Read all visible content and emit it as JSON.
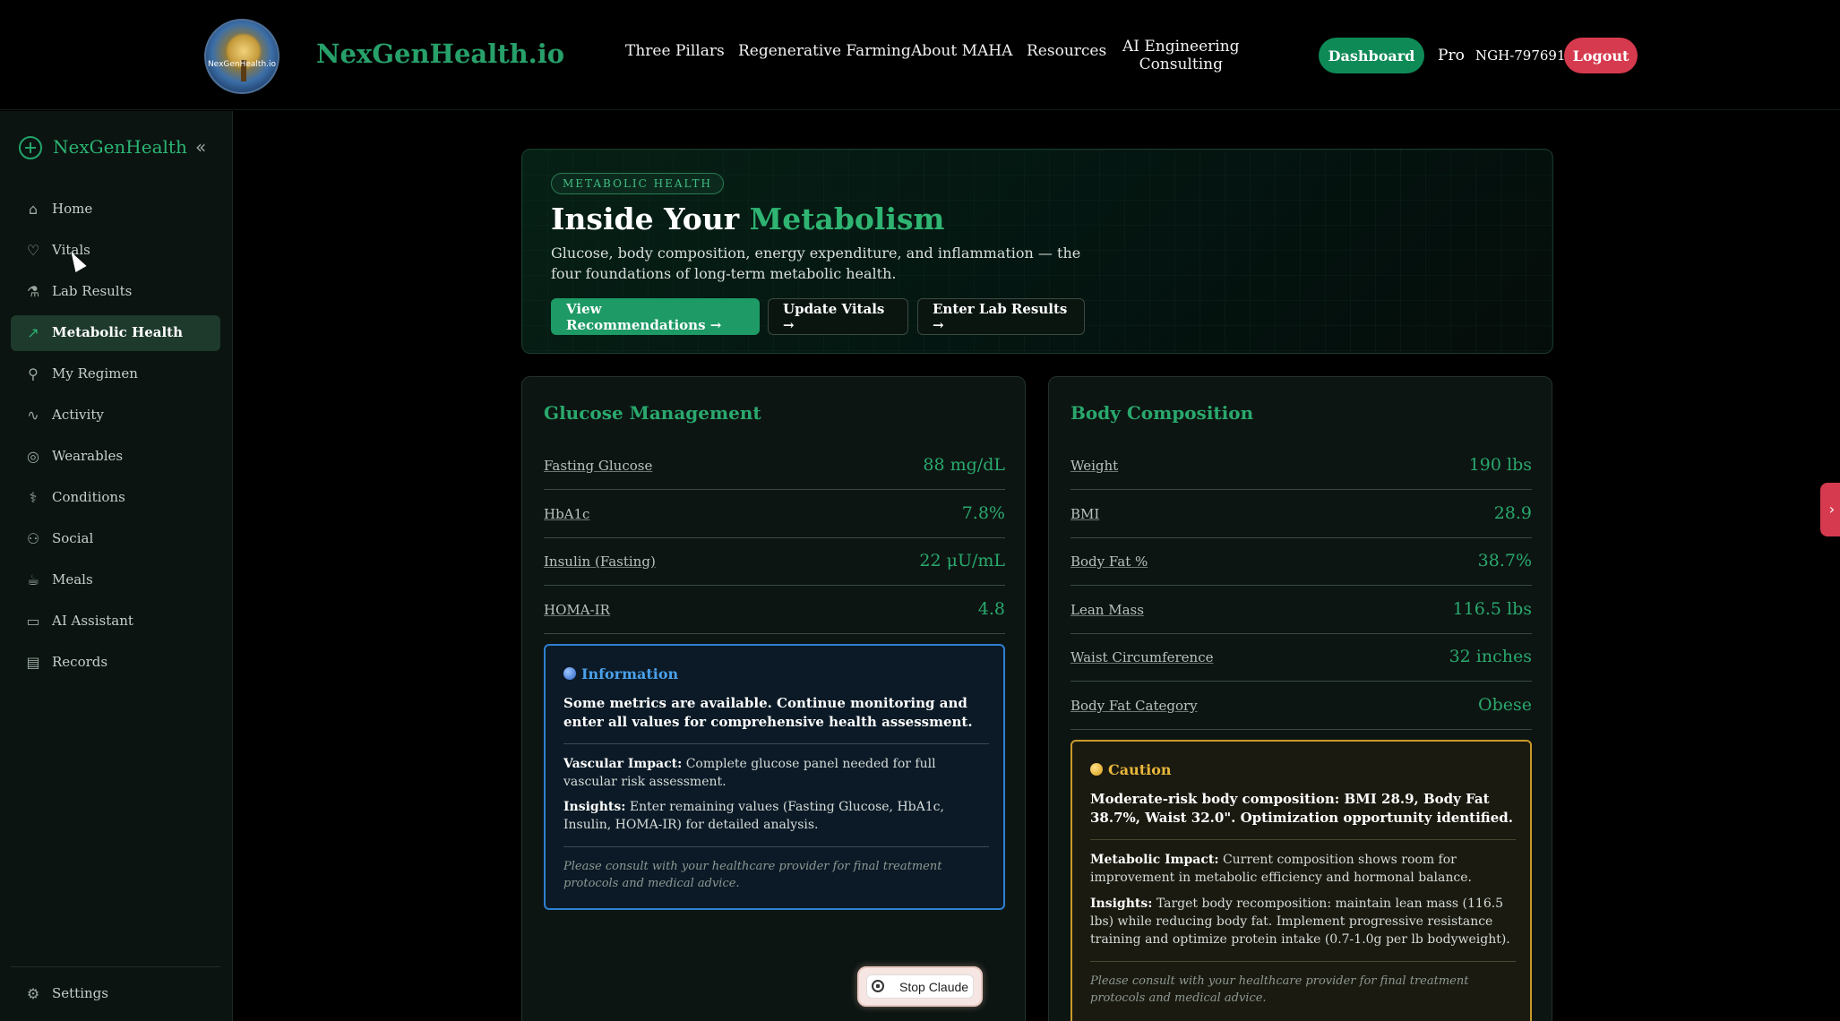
{
  "header": {
    "logo_text": "NexGenHealth.io",
    "brand": "NexGenHealth.io",
    "nav": [
      "Three Pillars",
      "Regenerative Farming",
      "About MAHA",
      "Resources"
    ],
    "nav_consulting_line1": "AI Engineering",
    "nav_consulting_line2": "Consulting",
    "dashboard_label": "Dashboard",
    "plan": "Pro",
    "user_id": "NGH-797691",
    "logout_label": "Logout"
  },
  "sidebar": {
    "brand": "NexGenHealth",
    "collapse_icon": "«",
    "items": [
      {
        "label": "Home",
        "icon": "home-icon"
      },
      {
        "label": "Vitals",
        "icon": "heart-icon"
      },
      {
        "label": "Lab Results",
        "icon": "flask-icon"
      },
      {
        "label": "Metabolic Health",
        "icon": "chart-icon",
        "active": true
      },
      {
        "label": "My Regimen",
        "icon": "pill-icon"
      },
      {
        "label": "Activity",
        "icon": "activity-icon"
      },
      {
        "label": "Wearables",
        "icon": "watch-icon"
      },
      {
        "label": "Conditions",
        "icon": "stethoscope-icon"
      },
      {
        "label": "Social",
        "icon": "users-icon"
      },
      {
        "label": "Meals",
        "icon": "cup-icon"
      },
      {
        "label": "AI Assistant",
        "icon": "chat-icon"
      },
      {
        "label": "Records",
        "icon": "document-icon"
      }
    ],
    "settings_label": "Settings"
  },
  "hero": {
    "badge": "METABOLIC HEALTH",
    "title_prefix": "Inside Your ",
    "title_accent": "Metabolism",
    "subtitle": "Glucose, body composition, energy expenditure, and inflammation — the four foundations of long-term metabolic health.",
    "buttons": [
      "View Recommendations →",
      "Update Vitals →",
      "Enter Lab Results →"
    ]
  },
  "glucose": {
    "title": "Glucose Management",
    "metrics": [
      {
        "label": "Fasting Glucose",
        "value": "88 mg/dL"
      },
      {
        "label": "HbA1c",
        "value": "7.8%"
      },
      {
        "label": "Insulin (Fasting)",
        "value": "22 μU/mL"
      },
      {
        "label": "HOMA-IR",
        "value": "4.8"
      }
    ],
    "info": {
      "heading": "Information",
      "main": "Some metrics are available. Continue monitoring and enter all values for comprehensive health assessment.",
      "impact_label": "Vascular Impact:",
      "impact_text": " Complete glucose panel needed for full vascular risk assessment.",
      "insights_label": "Insights:",
      "insights_text": " Enter remaining values (Fasting Glucose, HbA1c, Insulin, HOMA-IR) for detailed analysis.",
      "footer": "Please consult with your healthcare provider for final treatment protocols and medical advice."
    }
  },
  "body": {
    "title": "Body Composition",
    "metrics": [
      {
        "label": "Weight",
        "value": "190 lbs"
      },
      {
        "label": "BMI",
        "value": "28.9"
      },
      {
        "label": "Body Fat %",
        "value": "38.7%"
      },
      {
        "label": "Lean Mass",
        "value": "116.5 lbs"
      },
      {
        "label": "Waist Circumference",
        "value": "32 inches"
      },
      {
        "label": "Body Fat Category",
        "value": "Obese"
      }
    ],
    "caution": {
      "heading": "Caution",
      "main": "Moderate-risk body composition: BMI 28.9, Body Fat 38.7%, Waist 32.0\". Optimization opportunity identified.",
      "impact_label": "Metabolic Impact:",
      "impact_text": " Current composition shows room for improvement in metabolic efficiency and hormonal balance.",
      "insights_label": "Insights:",
      "insights_text": " Target body recomposition: maintain lean mass (116.5 lbs) while reducing body fat. Implement progressive resistance training and optimize protein intake (0.7-1.0g per lb bodyweight).",
      "footer": "Please consult with your healthcare provider for final treatment protocols and medical advice."
    }
  },
  "overlay": {
    "stop_label": "Stop Claude",
    "edge_tab_icon": "›"
  }
}
